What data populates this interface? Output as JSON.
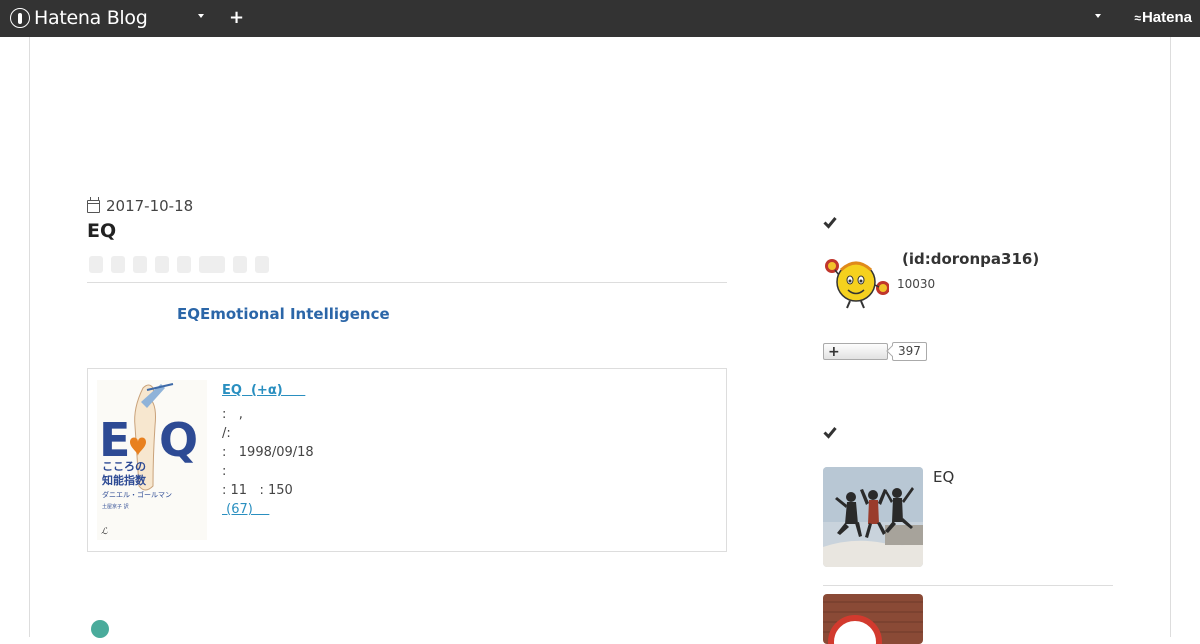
{
  "topbar": {
    "logo_text": "Hatena Blog",
    "brand_text": "Hatena",
    "colors": {
      "background": "#333333",
      "text": "#ffffff"
    },
    "icons": [
      "hatena-logo-icon",
      "dropdown-caret-icon",
      "plus-icon",
      "hatena-wave-icon"
    ]
  },
  "article": {
    "date": "2017-10-18",
    "title": "EQ",
    "lead": "EQEmotional Intelligence",
    "book": {
      "title": "EQ  (+α)     ",
      "meta": [
        ":   ,",
        "/:",
        ":   1998/09/18",
        ":",
        ": 11   : 150"
      ],
      "reviews": " (67)    ",
      "cover_text": {
        "big": "EQ",
        "line1": "こころの",
        "line2": "知能指数",
        "author": "ダニエル・ゴールマン",
        "translator": "土屋京子 訳"
      }
    }
  },
  "sidebar": {
    "profile": {
      "id": "(id:doronpa316)",
      "count": "10030",
      "follow_count": "397"
    },
    "entries": [
      {
        "title": "EQ"
      }
    ]
  },
  "colors": {
    "link_blue": "#2b66a8",
    "book_link": "#2a8fc0",
    "accent_teal": "#4aab9b"
  }
}
